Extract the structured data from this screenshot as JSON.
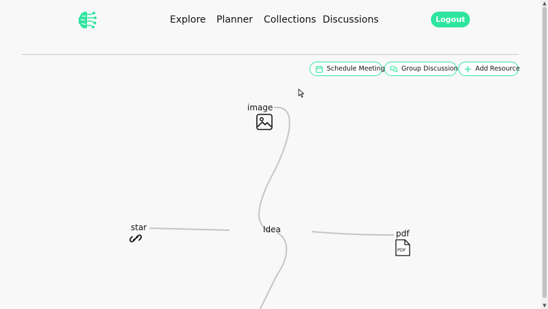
{
  "header": {
    "nav": [
      {
        "label": "Explore"
      },
      {
        "label": "Planner"
      },
      {
        "label": "Collections"
      },
      {
        "label": "Discussions"
      }
    ],
    "logout_label": "Logout"
  },
  "actions": {
    "schedule_label": "Schedule Meeting",
    "group_label": "Group Discussion",
    "add_label": "Add Resource"
  },
  "graph": {
    "center_label": "Idea",
    "nodes": {
      "image": {
        "label": "image",
        "icon": "image-icon"
      },
      "star": {
        "label": "star",
        "icon": "link-icon"
      },
      "pdf": {
        "label": "pdf",
        "icon": "pdf-icon",
        "icon_text": "PDF"
      }
    }
  },
  "colors": {
    "accent": "#2ee59d",
    "edge": "#c4c4c4",
    "background": "#f8f8f9"
  }
}
